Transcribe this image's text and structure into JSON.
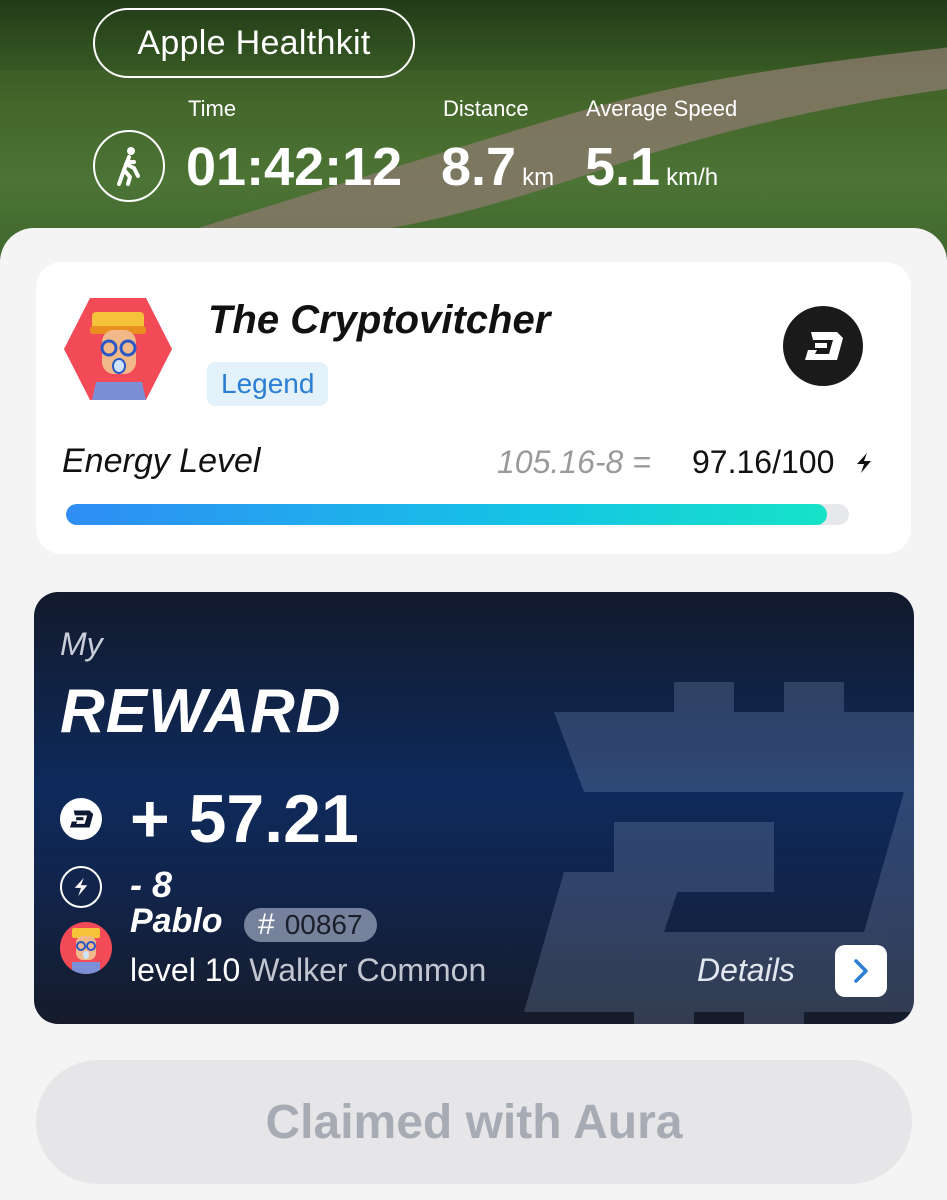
{
  "header": {
    "source_label": "Apple Healthkit",
    "stats": [
      {
        "label": "Time",
        "value": "01:42:12",
        "unit": ""
      },
      {
        "label": "Distance",
        "value": "8.7",
        "unit": "km"
      },
      {
        "label": "Average Speed",
        "value": "5.1",
        "unit": "km/h"
      }
    ]
  },
  "profile": {
    "name": "The Cryptovitcher",
    "badge": "Legend",
    "energy_label": "Energy Level",
    "energy_calc": "105.16-8 =",
    "energy_value": "97.16/100",
    "energy_fraction": 0.9716
  },
  "reward": {
    "my_label": "My",
    "title": "REWARD",
    "amount": "+ 57.21",
    "energy_cost": "- 8",
    "nft_name": "Pablo",
    "nft_hash": "#",
    "nft_id": "00867",
    "level_text": "level 10",
    "class_text": "Walker Common",
    "details_label": "Details"
  },
  "actions": {
    "claim_label": "Claimed with Aura"
  },
  "colors": {
    "accent_blue": "#2a7fd4",
    "energy_gradient_start": "#2f8df5",
    "energy_gradient_end": "#16e2c8",
    "reward_card_bg": "#0e2a5c"
  },
  "icons": {
    "activity": "walking-person-icon",
    "token": "token-logo-icon",
    "energy": "lightning-bolt-icon",
    "details": "chevron-right-icon"
  }
}
